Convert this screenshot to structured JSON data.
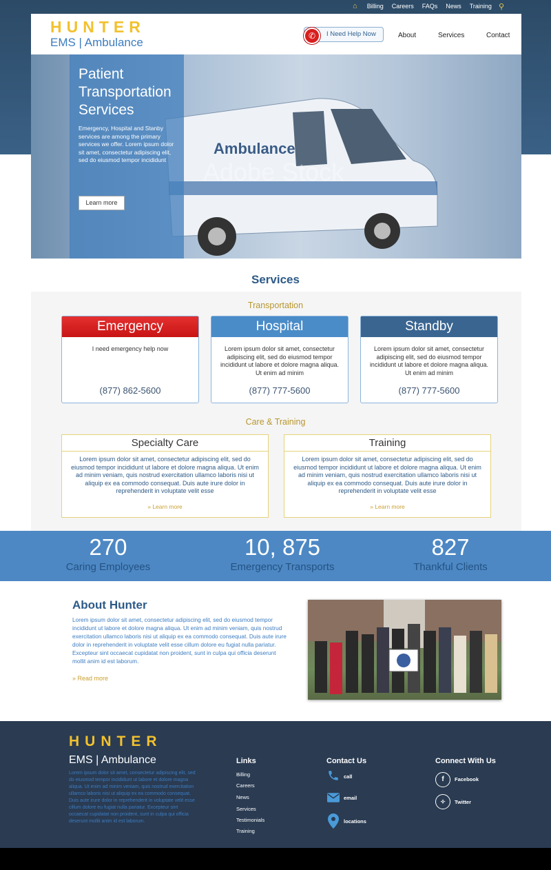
{
  "topnav": {
    "items": [
      "Billing",
      "Careers",
      "FAQs",
      "News",
      "Training"
    ]
  },
  "brand": {
    "name": "HUNTER",
    "sub": "EMS | Ambulance"
  },
  "header": {
    "help_label": "I Need Help Now",
    "nav": [
      "About",
      "Services",
      "Contact"
    ]
  },
  "hero": {
    "title": "Patient Transportation Services",
    "text": "Emergency, Hospital and Stanby services are among the primary services we offer. Lorem ipsum dolor sit amet, consectetur adipiscing elit, sed do eiusmod tempor incididunt",
    "button": "Learn more",
    "vehicle_text": "Ambulance",
    "watermark": "Adobe Stock"
  },
  "services": {
    "title": "Services",
    "transport_heading": "Transportation",
    "cards": [
      {
        "title": "Emergency",
        "text": "I need emergency help now",
        "phone": "(877) 862-5600",
        "color": "#d42020"
      },
      {
        "title": "Hospital",
        "text": "Lorem ipsum dolor sit amet, consectetur adipiscing elit, sed do eiusmod tempor incididunt ut labore et dolore magna aliqua. Ut enim ad minim",
        "phone": "(877) 777-5600",
        "color": "#4a8cc8"
      },
      {
        "title": "Standby",
        "text": "Lorem ipsum dolor sit amet, consectetur adipiscing elit, sed do eiusmod tempor incididunt ut labore et dolore magna aliqua. Ut enim ad minim",
        "phone": "(877) 777-5600",
        "color": "#3a6591"
      }
    ],
    "care_heading": "Care & Training",
    "care": [
      {
        "title": "Specialty Care",
        "text": "Lorem ipsum dolor sit amet, consectetur adipiscing elit, sed do eiusmod tempor incididunt ut labore et dolore magna aliqua. Ut enim ad minim veniam, quis nostrud exercitation ullamco laboris nisi ut aliquip ex ea commodo consequat. Duis aute irure dolor in reprehenderit in voluptate velit esse",
        "link": "Learn more"
      },
      {
        "title": "Training",
        "text": "Lorem ipsum dolor sit amet, consectetur adipiscing elit, sed do eiusmod tempor incididunt ut labore et dolore magna aliqua. Ut enim ad minim veniam, quis nostrud exercitation ullamco laboris nisi ut aliquip ex ea commodo consequat. Duis aute irure dolor in reprehenderit in voluptate velit esse",
        "link": "Learn more"
      }
    ]
  },
  "stats": [
    {
      "number": "270",
      "label": "Caring Employees"
    },
    {
      "number": "10, 875",
      "label": "Emergency Transports"
    },
    {
      "number": "827",
      "label": "Thankful Clients"
    }
  ],
  "about": {
    "title": "About Hunter",
    "text": "Lorem ipsum dolor sit amet, consectetur adipiscing elit, sed do eiusmod tempor incididunt ut labore et dolore magna aliqua. Ut enim ad minim veniam, quis nostrud exercitation ullamco laboris nisi ut aliquip ex ea commodo consequat. Duis aute irure dolor in reprehenderit in voluptate velit esse cillum dolore eu fugiat nulla pariatur. Excepteur sint occaecat cupidatat non proident, sunt in culpa qui officia deserunt mollit anim id est laborum.",
    "more": "Read more"
  },
  "footer": {
    "text": "Lorem ipsum dolor sit amet, consectetur adipiscing elit, sed do eiusmod tempor incididunt ut labore et dolore magna aliqua. Ut enim ad minim veniam, quis nostrud exercitation ullamco laboris nisi ut aliquip ex ea commodo consequat. Duis aute irure dolor in reprehenderit in voluptate velit esse cillum dolore eu fugiat nulla pariatur. Excepteur sint occaecat cupidatat non proident, sunt in culpa qui officia deserunt mollit anim id est laborum.",
    "links_heading": "Links",
    "links": [
      "Billing",
      "Careers",
      "News",
      "Services",
      "Testimonials",
      "Training"
    ],
    "contact_heading": "Contact Us",
    "contact": [
      "call",
      "email",
      "locations"
    ],
    "connect_heading": "Connect With Us",
    "social": [
      "Facebook",
      "Twitter"
    ]
  },
  "icons": {
    "home": "home-icon",
    "search": "search-icon",
    "phone": "phone-icon",
    "mail": "mail-icon",
    "pin": "location-pin-icon",
    "facebook": "facebook-icon",
    "twitter": "twitter-icon"
  },
  "colors": {
    "brand_gold": "#f2c12e",
    "brand_blue": "#3c7cc0",
    "emergency_red": "#d42020",
    "stats_blue": "#4d88c4",
    "footer_navy": "#2a3b52"
  }
}
